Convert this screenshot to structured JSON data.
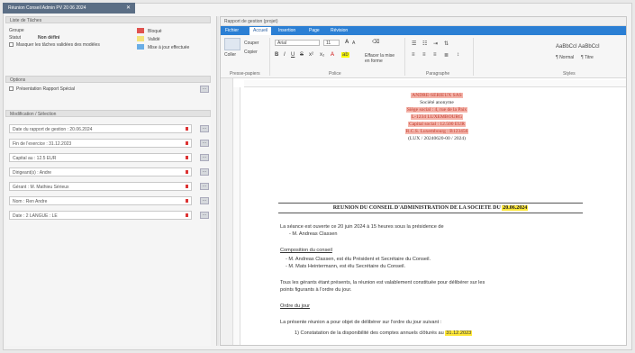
{
  "doc_tab": {
    "title": "Réunion Conseil Admin PV 20 06 2024",
    "close": "✕"
  },
  "left": {
    "section_liste": "Liste de Tâches",
    "label_groupe": "Groupe",
    "label_statut": "Statut",
    "value_statut": "Non défini",
    "check_masquer": "Masquer les tâches validées des modèles",
    "legend": [
      {
        "label": "Bloqué",
        "color": "#e0534f"
      },
      {
        "label": "Validé",
        "color": "#f3e37a"
      },
      {
        "label": "Mise à jour effectuée",
        "color": "#6aaee6"
      }
    ],
    "section_options": "Options",
    "check_options": "Présentation Rapport Spécial",
    "section_modif": "Modification / Sélection",
    "fields": [
      "Date du rapport de gestion : 20.06.2024",
      "Fin de l'exercice : 31.12.2023",
      "Capital au : 12.5 EUR",
      "Dirigeant(s) : Andre",
      "Gérant : M. Mathieu Sérieux",
      "Nom : Ren Andre",
      "Date : 2 LANGUE : LE"
    ],
    "btn": "···"
  },
  "editor": {
    "title": "Rapport de gestion (projet)",
    "tabs": [
      "Fichier",
      "Accueil",
      "Insertion",
      "Page",
      "Révision"
    ],
    "ribbon": {
      "paste": "Coller",
      "cut": "Couper",
      "copy": "Copier",
      "font": "Arial",
      "size": "11",
      "clear": "Effacer la mise en forme",
      "styles_preview": "AaBbCcI  AaBbCcI",
      "style1": "¶ Normal",
      "style2": "¶ Titre",
      "groups": [
        "Presse-papiers",
        "Police",
        "Paragraphe",
        "Styles"
      ]
    },
    "doc": {
      "hdr": [
        "ANDRE-SERIEUX SAS",
        "Société anonyme",
        "Siège social :  4, rue de la Paix",
        "L-1234 LUXEMBOURG",
        "Capital social : 12.500 EUR",
        "R.C.S. Luxembourg : B123456",
        "(LUX / 20240620-00 / 2024)"
      ],
      "title_prefix": "REUNION DU CONSEIL D'ADMINISTRATION DE LA SOCIETE DU ",
      "title_date": "20.06.2024",
      "p1": "La séance est ouverte ce 20 juin 2024 à 15 heures sous la présidence de",
      "p1b": "- M. Andreas Classen",
      "p2_head": "Composition du conseil",
      "p2a": "- M. Andreas Classen, est élu Président et Secrétaire du Conseil.",
      "p2b": "- M. Mats Heintermann, est élu Secrétaire du Conseil.",
      "p3": "Tous les gérants étant présents, la réunion est valablement constituée pour délibérer sur les",
      "p3b": "points figurants à l'ordre du jour.",
      "p4_head": "Ordre du jour",
      "p5": "La présente réunion a pour objet de délibérer sur l'ordre du jour suivant :",
      "p6_prefix": "1)  Constatation de la disponibilité des comptes annuels clôturés au ",
      "p6_date": "31.12.2023"
    }
  }
}
